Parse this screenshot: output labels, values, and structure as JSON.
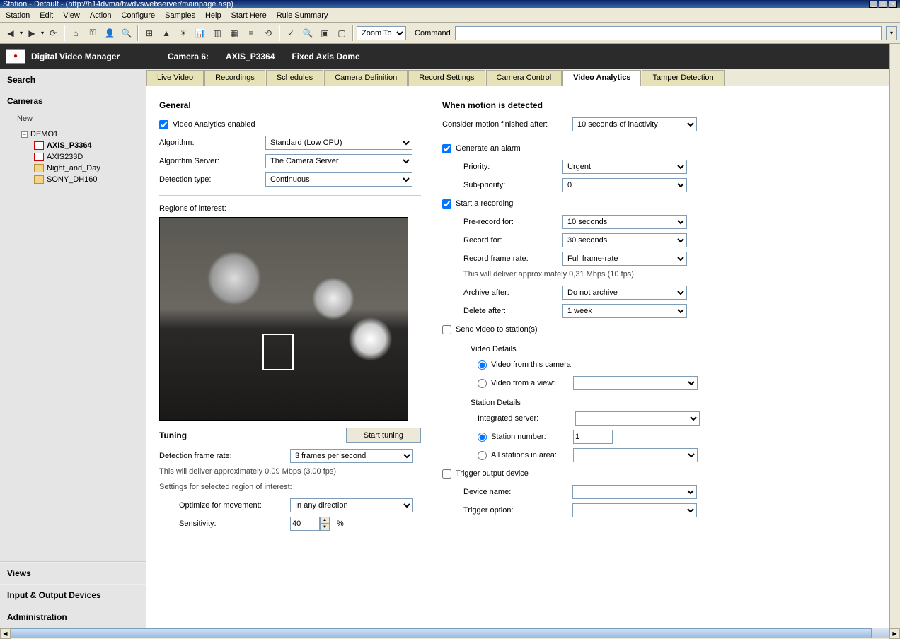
{
  "window": {
    "title": "Station - Default - (http://h14dvma/hwdvswebserver/mainpage.asp)"
  },
  "menu": [
    "Station",
    "Edit",
    "View",
    "Action",
    "Configure",
    "Samples",
    "Help",
    "Start Here",
    "Rule Summary"
  ],
  "toolbar": {
    "zoom_label": "Zoom To Fit",
    "command_label": "Command"
  },
  "sidebar": {
    "app_title": "Digital Video Manager",
    "sections": {
      "search": "Search",
      "cameras": "Cameras",
      "new": "New",
      "views": "Views",
      "io": "Input & Output Devices",
      "admin": "Administration"
    },
    "tree": {
      "root": "DEMO1",
      "items": [
        "AXIS_P3364",
        "AXIS233D",
        "Night_and_Day",
        "SONY_DH160"
      ]
    }
  },
  "header": {
    "camera_label": "Camera 6:",
    "camera_name": "AXIS_P3364",
    "camera_type": "Fixed Axis Dome"
  },
  "tabs": [
    "Live Video",
    "Recordings",
    "Schedules",
    "Camera Definition",
    "Record Settings",
    "Camera Control",
    "Video Analytics",
    "Tamper Detection"
  ],
  "general": {
    "title": "General",
    "enabled_label": "Video Analytics enabled",
    "algorithm_label": "Algorithm:",
    "algorithm_value": "Standard (Low CPU)",
    "server_label": "Algorithm Server:",
    "server_value": "The Camera Server",
    "detection_label": "Detection type:",
    "detection_value": "Continuous",
    "roi_label": "Regions of interest:"
  },
  "tuning": {
    "title": "Tuning",
    "start_btn": "Start tuning",
    "framerate_label": "Detection frame rate:",
    "framerate_value": "3 frames per second",
    "note": "This will deliver approximately 0,09 Mbps (3,00 fps)",
    "settings_label": "Settings for selected region of interest:",
    "optimize_label": "Optimize for movement:",
    "optimize_value": "In any direction",
    "sensitivity_label": "Sensitivity:",
    "sensitivity_value": "40",
    "sensitivity_unit": "%"
  },
  "motion": {
    "title": "When motion is detected",
    "finished_label": "Consider motion finished after:",
    "finished_value": "10 seconds of inactivity",
    "alarm_label": "Generate an alarm",
    "priority_label": "Priority:",
    "priority_value": "Urgent",
    "subpriority_label": "Sub-priority:",
    "subpriority_value": "0",
    "recording_label": "Start a recording",
    "prerecord_label": "Pre-record for:",
    "prerecord_value": "10 seconds",
    "recordfor_label": "Record for:",
    "recordfor_value": "30 seconds",
    "recordrate_label": "Record frame rate:",
    "recordrate_value": "Full frame-rate",
    "record_note": "This will deliver approximately 0,31 Mbps (10 fps)",
    "archive_label": "Archive after:",
    "archive_value": "Do not archive",
    "delete_label": "Delete after:",
    "delete_value": "1 week",
    "sendvideo_label": "Send video to station(s)",
    "videodetails_label": "Video Details",
    "fromcamera_label": "Video from this camera",
    "fromview_label": "Video from a view:",
    "stationdetails_label": "Station Details",
    "intserver_label": "Integrated server:",
    "stationnum_label": "Station number:",
    "stationnum_value": "1",
    "allstations_label": "All stations in area:",
    "trigger_label": "Trigger output device",
    "devicename_label": "Device name:",
    "triggeropt_label": "Trigger option:"
  }
}
